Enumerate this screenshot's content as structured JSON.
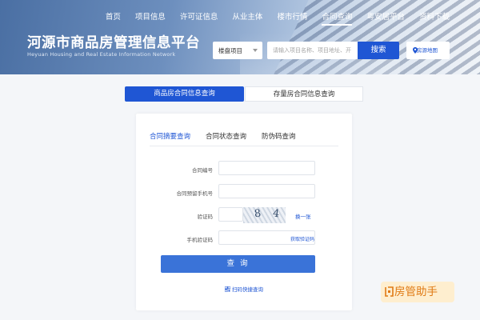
{
  "nav": {
    "items": [
      {
        "label": "首页"
      },
      {
        "label": "项目信息"
      },
      {
        "label": "许可证信息"
      },
      {
        "label": "从业主体"
      },
      {
        "label": "楼市行情"
      },
      {
        "label": "合同查询"
      },
      {
        "label": "粤安居平台"
      },
      {
        "label": "资料下载"
      }
    ],
    "active_index": 5
  },
  "header": {
    "title": "河源市商品房管理信息平台",
    "subtitle": "Heyuan Housing and Real Estate Information Network"
  },
  "search": {
    "select_value": "楼盘项目",
    "placeholder": "请输入项目名称、项目地址、开",
    "button_label": "搜索",
    "map_label": "房源地图"
  },
  "main_tabs": [
    {
      "label": "商品房合同信息查询",
      "active": true
    },
    {
      "label": "存量房合同信息查询",
      "active": false
    }
  ],
  "sub_tabs": [
    {
      "label": "合同摘要查询",
      "active": true
    },
    {
      "label": "合同状态查询",
      "active": false
    },
    {
      "label": "防伪码查询",
      "active": false
    }
  ],
  "form": {
    "contract_no_label": "合同编号",
    "phone_label": "合同预留手机号",
    "captcha_label": "验证码",
    "captcha_chars": [
      "8",
      "4"
    ],
    "refresh_label": "换一张",
    "sms_label": "手机验证码",
    "get_sms_label": "获取验证码",
    "submit_label": "查 询",
    "scan_label": "扫码快捷查询"
  },
  "watermark": {
    "text": "房管助手"
  },
  "colors": {
    "primary": "#1f56d4",
    "button": "#3a73d8",
    "watermark": "#e07a14"
  }
}
